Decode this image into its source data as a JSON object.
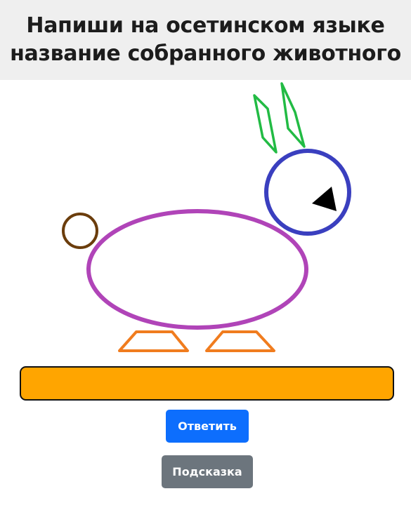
{
  "header": {
    "title_line1": "Напиши на осетинском языке",
    "title_line2": "название собранного животного"
  },
  "answer_input": {
    "value": "",
    "placeholder": ""
  },
  "buttons": {
    "answer_label": "Ответить",
    "hint_label": "Подсказка"
  },
  "colors": {
    "header_bg": "#efefef",
    "input_bg": "#ffa500",
    "answer_button": "#0d6efd",
    "hint_button": "#6c757d",
    "ears": "#22bb44",
    "head": "#3a3fbf",
    "eye": "#000000",
    "tail": "#6b3d0c",
    "body": "#b044b8",
    "feet": "#f07c1e"
  },
  "figure": {
    "parts": [
      "ear-left",
      "ear-right",
      "head-circle",
      "eye-triangle",
      "tail-circle",
      "body-ellipse",
      "foot-left",
      "foot-right"
    ]
  }
}
